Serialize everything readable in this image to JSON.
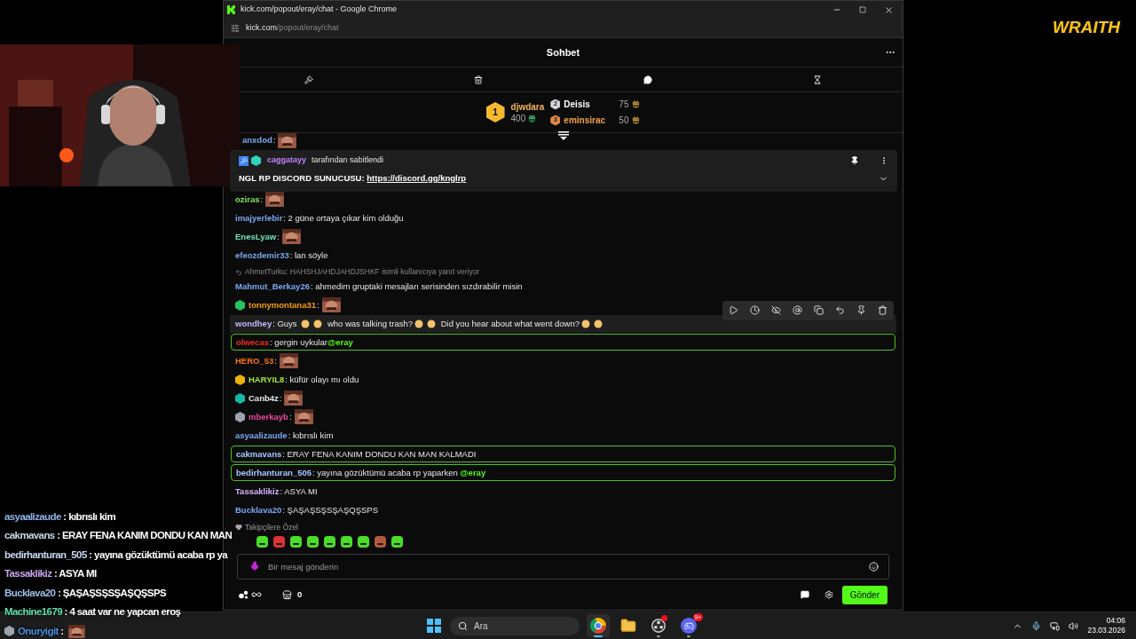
{
  "logo": {
    "text": "WRAITH"
  },
  "browser": {
    "title": "kick.com/popout/eray/chat - Google Chrome",
    "url_host": "kick.com",
    "url_path": "/popout/eray/chat"
  },
  "chat": {
    "title": "Sohbet",
    "leaderboard": [
      {
        "rank": "1",
        "name": "djwdara",
        "amount": "400",
        "color": "#f0b45c"
      },
      {
        "rank": "2",
        "name": "Deisis",
        "amount": "75",
        "color": "#ffffff"
      },
      {
        "rank": "3",
        "name": "eminsirac",
        "amount": "50",
        "color": "#f0a24a"
      }
    ],
    "pinned": {
      "by": "caggatayy",
      "note": "tarafından sabitlendi",
      "text": "NGL RP DISCORD SUNUCUSU: ",
      "link": "https://discord.gg/knglrp"
    },
    "messages": [
      {
        "user": "anxdod",
        "color": "#7aa7f0",
        "kind": "plain",
        "parts": [
          {
            "kind": "text",
            "text": ":"
          },
          {
            "kind": "emote"
          }
        ]
      },
      {
        "user": "oziras",
        "color": "#84e35a",
        "kind": "plain",
        "parts": [
          {
            "kind": "text",
            "text": ":"
          },
          {
            "kind": "emote"
          }
        ]
      },
      {
        "user": "imajyerlebir",
        "color": "#7aa7f0",
        "kind": "plain",
        "parts": [
          {
            "kind": "text",
            "text": ": 2 güne ortaya çıkar kim olduğu"
          }
        ]
      },
      {
        "user": "EnesLyaw",
        "color": "#6ee7b7",
        "kind": "plain",
        "parts": [
          {
            "kind": "text",
            "text": ":"
          },
          {
            "kind": "emote"
          }
        ]
      },
      {
        "user": "efeozdemir33",
        "color": "#7aa7f0",
        "kind": "plain",
        "parts": [
          {
            "kind": "text",
            "text": ": lan söyle"
          }
        ]
      },
      {
        "user": "Mahmut_Berkay26",
        "color": "#7aa7f0",
        "kind": "plain",
        "reply": "AhmetTurku: HAHSHJAHDJAHDJSHKF isimli kullanıcıya yanıt veriyor",
        "parts": [
          {
            "kind": "text",
            "text": ": ahmedim gruptaki mesajları serisinden sızdırabilir misin"
          }
        ]
      },
      {
        "user": "tonnymontana31",
        "color": "#f59e0b",
        "badge": {
          "color": "#22c55e"
        },
        "kind": "plain",
        "parts": [
          {
            "kind": "text",
            "text": ":"
          },
          {
            "kind": "emote"
          }
        ]
      },
      {
        "user": "wondhey",
        "color": "#c4b5fd",
        "kind": "hovered",
        "parts": [
          {
            "kind": "text",
            "text": ": Guys "
          },
          {
            "kind": "emoji"
          },
          {
            "kind": "emoji"
          },
          {
            "kind": "text",
            "text": " who was talking trash?"
          },
          {
            "kind": "emoji"
          },
          {
            "kind": "emoji"
          },
          {
            "kind": "text",
            "text": " Did you hear about what went down?"
          },
          {
            "kind": "emoji"
          },
          {
            "kind": "emoji"
          }
        ]
      },
      {
        "user": "olwecas",
        "color": "#ef2b2b",
        "kind": "highlight",
        "parts": [
          {
            "kind": "text",
            "text": ": gergin uykular"
          },
          {
            "kind": "mention",
            "text": "@eray"
          }
        ]
      },
      {
        "user": "HERO_53",
        "color": "#f97316",
        "kind": "plain",
        "parts": [
          {
            "kind": "text",
            "text": ":"
          },
          {
            "kind": "emote"
          }
        ]
      },
      {
        "user": "HARYIL8",
        "color": "#a3e635",
        "badge": {
          "color": "#eab308"
        },
        "kind": "plain",
        "parts": [
          {
            "kind": "text",
            "text": ": küfür olayı mı oldu"
          }
        ]
      },
      {
        "user": "Canb4z",
        "color": "#e5e7eb",
        "badge": {
          "color": "#14b8a6"
        },
        "kind": "plain",
        "parts": [
          {
            "kind": "text",
            "text": ":"
          },
          {
            "kind": "emote"
          }
        ]
      },
      {
        "user": "mberkayb",
        "color": "#ec4899",
        "badge": {
          "color": "#9ca3af"
        },
        "kind": "plain",
        "parts": [
          {
            "kind": "text",
            "text": ":"
          },
          {
            "kind": "emote"
          }
        ]
      },
      {
        "user": "asyaalizaude",
        "color": "#7aa7f0",
        "kind": "plain",
        "parts": [
          {
            "kind": "text",
            "text": ": kıbrıslı kim"
          }
        ]
      },
      {
        "user": "cakmavans",
        "color": "#a8c8ff",
        "kind": "highlight",
        "parts": [
          {
            "kind": "text",
            "text": ": ERAY FENA KANIM DONDU KAN MAN KALMADI"
          }
        ]
      },
      {
        "user": "bedirhanturan_505",
        "color": "#a8c8ff",
        "kind": "highlight",
        "parts": [
          {
            "kind": "text",
            "text": ": yayına gözüktümü acaba rp yaparken "
          },
          {
            "kind": "mention",
            "text": "@eray"
          }
        ]
      },
      {
        "user": "Tassaklikiz",
        "color": "#d8b4fe",
        "kind": "plain",
        "parts": [
          {
            "kind": "text",
            "text": ": ASYA MI"
          }
        ]
      },
      {
        "user": "Bucklava20",
        "color": "#7aa7f0",
        "kind": "plain",
        "parts": [
          {
            "kind": "text",
            "text": ": ŞAŞAŞSŞSŞAŞQŞSPS"
          }
        ]
      }
    ],
    "followers_only": "Takipçilere Özel",
    "input": {
      "placeholder": "Bir mesaj gönderin"
    },
    "store_count": "0",
    "send": "Gönder"
  },
  "overlay_chat": [
    {
      "user": "asyaalizaude",
      "color": "#8fb3e8",
      "text": " : kıbrıslı kim"
    },
    {
      "user": "cakmavans",
      "color": "#c9d8ee",
      "text": " : ERAY FENA KANIM DONDU KAN MAN"
    },
    {
      "user": "bedirhanturan_505",
      "color": "#c9d8ee",
      "text": " : yayına gözüktümü acaba rp ya"
    },
    {
      "user": "Tassaklikiz",
      "color": "#c9a6f0",
      "text": " : ASYA MI"
    },
    {
      "user": "Bucklava20",
      "color": "#9fbde8",
      "text": " : ŞAŞAŞSŞSŞAŞQŞSPS"
    },
    {
      "user": "Machine1679",
      "color": "#5ee0a8",
      "text": " : 4 saat var ne yapcan eroş"
    },
    {
      "user": "Onuryigit",
      "color": "#4a90e2",
      "text": " :",
      "badge": true,
      "emote": true
    }
  ],
  "taskbar": {
    "search_placeholder": "Ara",
    "apps": [
      {
        "kind": "browser",
        "selected": true,
        "running": true
      },
      {
        "kind": "folder",
        "selected": false,
        "running": false
      },
      {
        "kind": "recorder",
        "selected": false,
        "running": true,
        "alert": true
      },
      {
        "kind": "chat",
        "selected": false,
        "running": true,
        "badge": "9+"
      }
    ],
    "time": "04:06",
    "date": "23.03.2026"
  }
}
